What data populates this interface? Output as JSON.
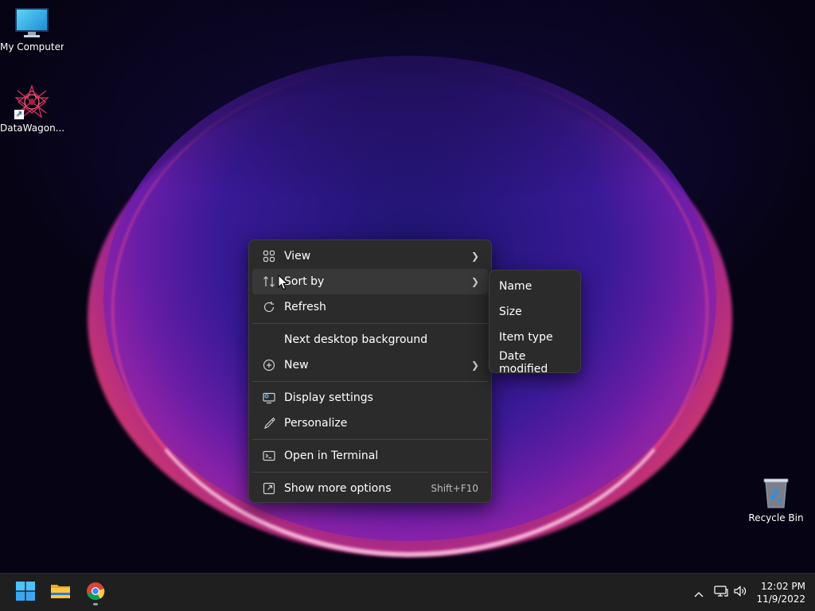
{
  "desktop": {
    "icons": [
      {
        "label": "My Computer",
        "icon": "monitor-icon"
      },
      {
        "label": "DataWagon...",
        "icon": "app-star-icon"
      },
      {
        "label": "Recycle Bin",
        "icon": "recycle-bin-icon"
      }
    ]
  },
  "context_menu": {
    "items": [
      {
        "label": "View",
        "icon": "view-grid-icon",
        "has_submenu": true
      },
      {
        "label": "Sort by",
        "icon": "sort-arrows-icon",
        "has_submenu": true,
        "highlighted": true
      },
      {
        "label": "Refresh",
        "icon": "refresh-icon",
        "has_submenu": false
      },
      {
        "label": "Next desktop background",
        "icon": "",
        "has_submenu": false
      },
      {
        "label": "New",
        "icon": "plus-circle-icon",
        "has_submenu": true
      },
      {
        "label": "Display settings",
        "icon": "display-settings-icon",
        "has_submenu": false
      },
      {
        "label": "Personalize",
        "icon": "brush-icon",
        "has_submenu": false
      },
      {
        "label": "Open in Terminal",
        "icon": "terminal-icon",
        "has_submenu": false
      },
      {
        "label": "Show more options",
        "icon": "show-more-icon",
        "has_submenu": false,
        "shortcut": "Shift+F10"
      }
    ]
  },
  "sort_submenu": {
    "items": [
      "Name",
      "Size",
      "Item type",
      "Date modified"
    ]
  },
  "taskbar": {
    "apps": [
      {
        "name": "Start",
        "icon": "windows-logo-icon"
      },
      {
        "name": "File Explorer",
        "icon": "folder-icon"
      },
      {
        "name": "Google Chrome",
        "icon": "chrome-icon",
        "running": true
      }
    ],
    "tray": {
      "time": "12:02 PM",
      "date": "11/9/2022"
    }
  },
  "colors": {
    "menu_bg": "#2b2b2b",
    "menu_hover": "#383838",
    "taskbar_bg": "#1f1f1f",
    "accent_blue": "#1e90ff"
  }
}
